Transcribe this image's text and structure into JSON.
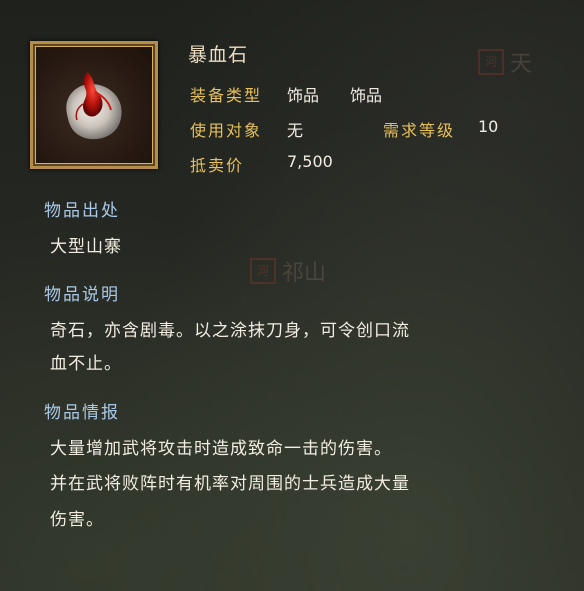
{
  "item": {
    "name": "暴血石",
    "equip_type_label": "装备类型",
    "equip_type_value_1": "饰品",
    "equip_type_value_2": "饰品",
    "target_label": "使用对象",
    "target_value": "无",
    "level_label": "需求等级",
    "level_value": "10",
    "price_label": "抵卖价",
    "price_value": "7,500",
    "icon": "blood-stone-icon"
  },
  "sections": {
    "origin_title": "物品出处",
    "origin_text": "大型山寨",
    "desc_title": "物品说明",
    "desc_line1": "奇石，亦含剧毒。以之涂抹刀身，可令创口流",
    "desc_line2": "血不止。",
    "info_title": "物品情报",
    "info_line1": "大量增加武将攻击时造成致命一击的伤害。",
    "info_line2": "并在武将败阵时有机率对周围的士兵造成大量",
    "info_line3": "伤害。"
  },
  "map": {
    "label_1": "天",
    "label_2": "祁山",
    "stamp_1": "河",
    "stamp_2": "河"
  },
  "colors": {
    "label_gold": "#e6c05a",
    "section_blue": "#a9c9e8",
    "text_white": "#f2ede2",
    "frame_gold": "#b58d49"
  }
}
